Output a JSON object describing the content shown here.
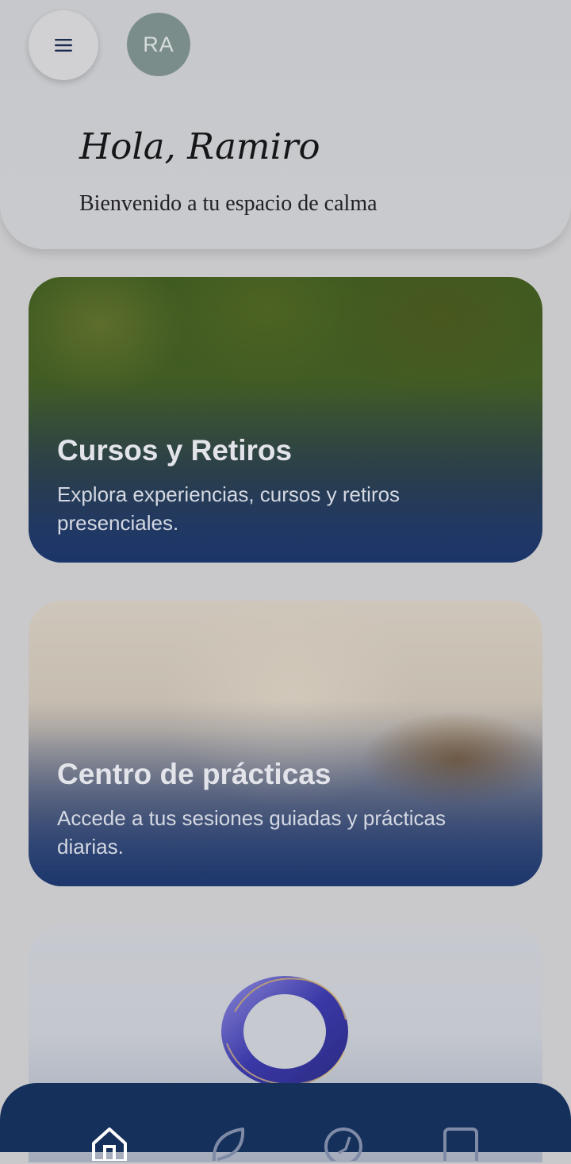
{
  "header": {
    "menu_icon": "hamburger-menu-icon",
    "avatar_initials": "RA",
    "greeting": "Hola, Ramiro",
    "subtitle": "Bienvenido a tu espacio de calma"
  },
  "cards": [
    {
      "title": "Cursos y Retiros",
      "description": "Explora experiencias, cursos y retiros presenciales."
    },
    {
      "title": "Centro de prácticas",
      "description": "Accede a tus sesiones guiadas y prácticas diarias."
    }
  ],
  "featured": {
    "image": "orb-logo-icon"
  },
  "tabbar": {
    "items": [
      "home-icon",
      "leaf-icon",
      "compass-icon",
      "book-icon"
    ]
  },
  "colors": {
    "tabbar": "#15305a",
    "avatar": "#7b8d8b",
    "background": "#c9c9cb"
  }
}
